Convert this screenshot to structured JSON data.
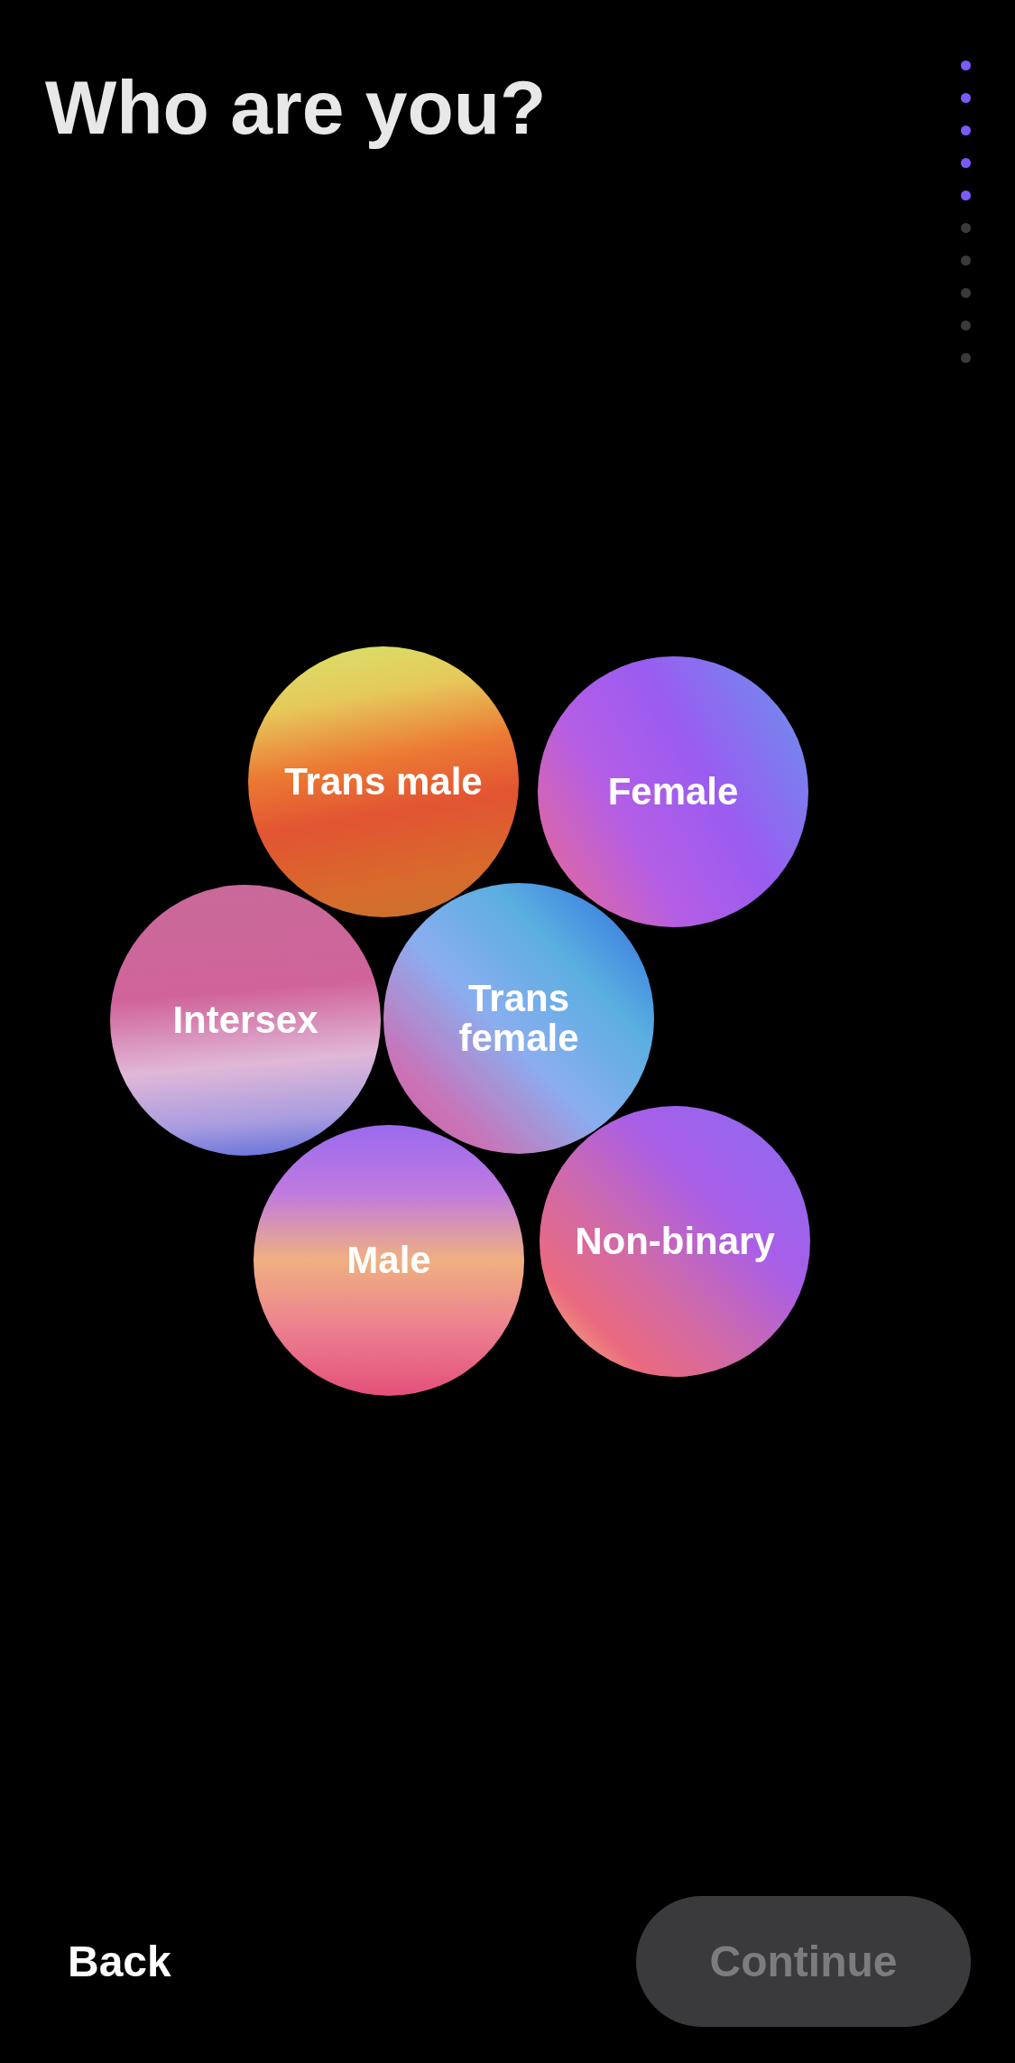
{
  "title": "Who are you?",
  "progress": [
    {
      "filled": true
    },
    {
      "filled": true
    },
    {
      "filled": true
    },
    {
      "filled": true
    },
    {
      "filled": true
    },
    {
      "filled": false
    },
    {
      "filled": false
    },
    {
      "filled": false
    },
    {
      "filled": false
    },
    {
      "filled": false
    }
  ],
  "options": [
    {
      "label": "Trans male",
      "selected": false
    },
    {
      "label": "Female",
      "selected": false
    },
    {
      "label": "Intersex",
      "selected": false
    },
    {
      "label": "Trans female",
      "selected": false
    },
    {
      "label": "Male",
      "selected": false
    },
    {
      "label": "Non-binary",
      "selected": false
    }
  ],
  "back_button": {
    "label": "Back"
  },
  "continue_button": {
    "label": "Continue",
    "disabled": true
  }
}
